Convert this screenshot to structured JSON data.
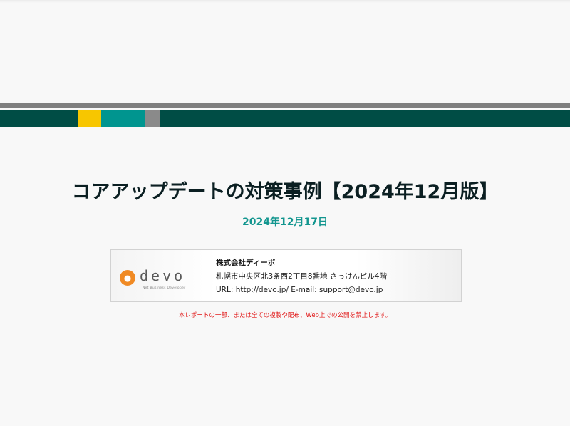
{
  "cover": {
    "title": "コアアップデートの対策事例【2024年12月版】",
    "date": "2024年12月17日"
  },
  "company_card": {
    "logo_text": "devo",
    "logo_tagline": "Net Business Developer",
    "company_name": "株式会社ディーボ",
    "address": "札幌市中央区北3条西2丁目8番地 さっけんビル4階",
    "contact": "URL: http://devo.jp/   E-mail: support@devo.jp"
  },
  "notice": "本レポートの一部、または全ての複製や配布、Web上での公開を禁止します。",
  "colors": {
    "band_dark": "#004d45",
    "accent_yellow": "#f7c600",
    "accent_teal": "#00958f",
    "accent_gray": "#8a8a8a",
    "date_text": "#13968f",
    "notice_text": "#e01010",
    "logo_orange": "#f08a24"
  }
}
